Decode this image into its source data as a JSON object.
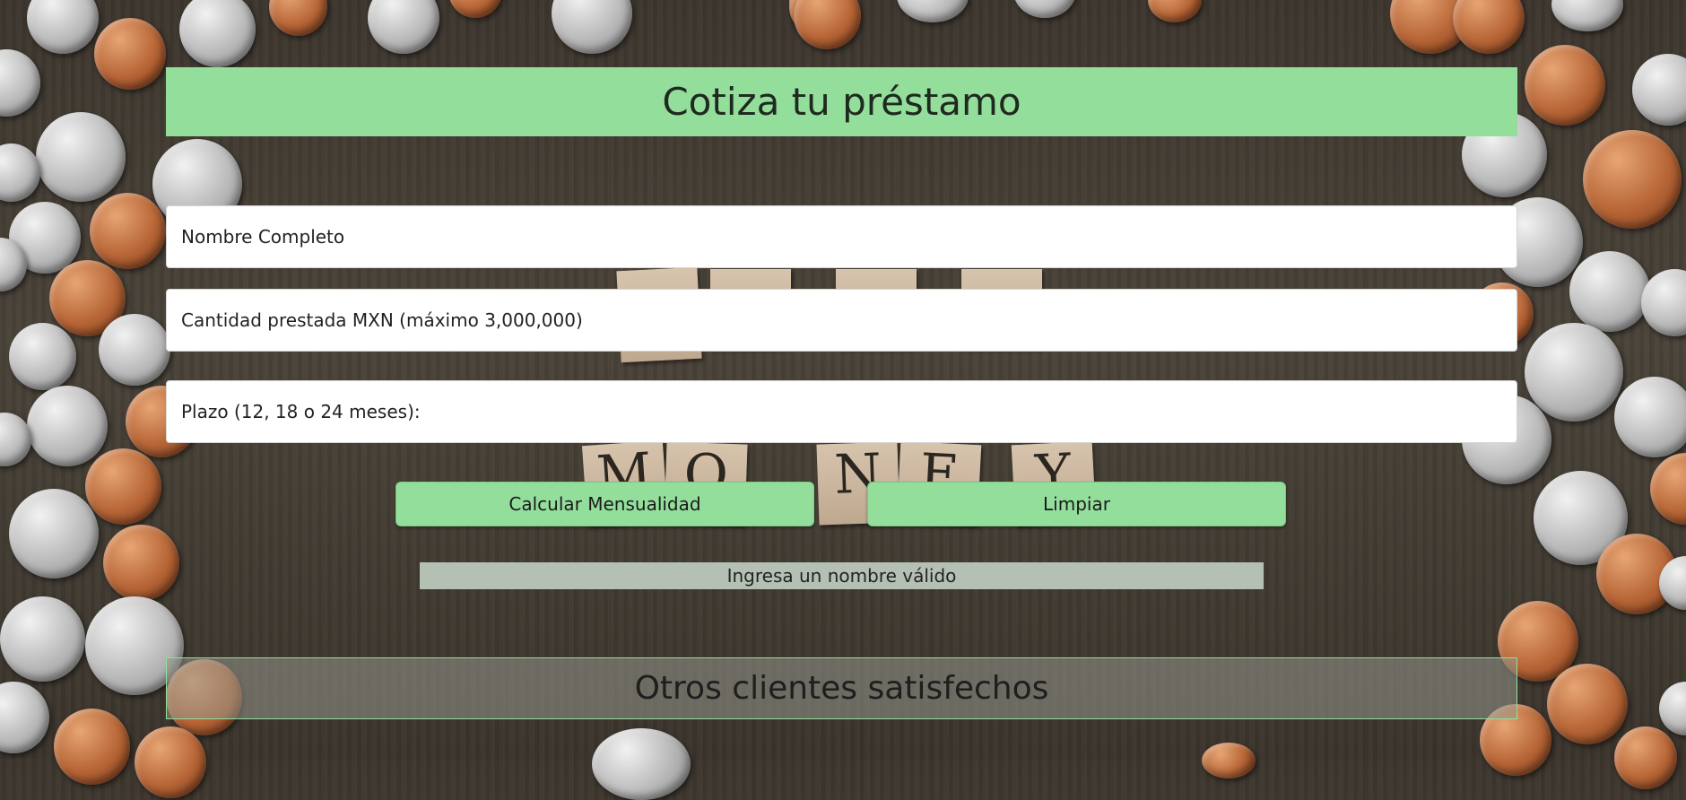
{
  "header": {
    "title": "Cotiza tu préstamo"
  },
  "form": {
    "name_placeholder": "Nombre Completo",
    "amount_placeholder": "Cantidad prestada MXN (máximo 3,000,000)",
    "term_placeholder": "Plazo (12, 18 o 24 meses):",
    "calculate_label": "Calcular Mensualidad",
    "clear_label": "Limpiar"
  },
  "status": {
    "message": "Ingresa un nombre válido"
  },
  "testimonials": {
    "title": "Otros clientes satisfechos"
  },
  "background": {
    "tile_letters": [
      "M",
      "O",
      "N",
      "E",
      "Y"
    ]
  },
  "colors": {
    "accent": "#94de9c",
    "alert_bg": "#b4c0b3",
    "background": "#433c33"
  }
}
